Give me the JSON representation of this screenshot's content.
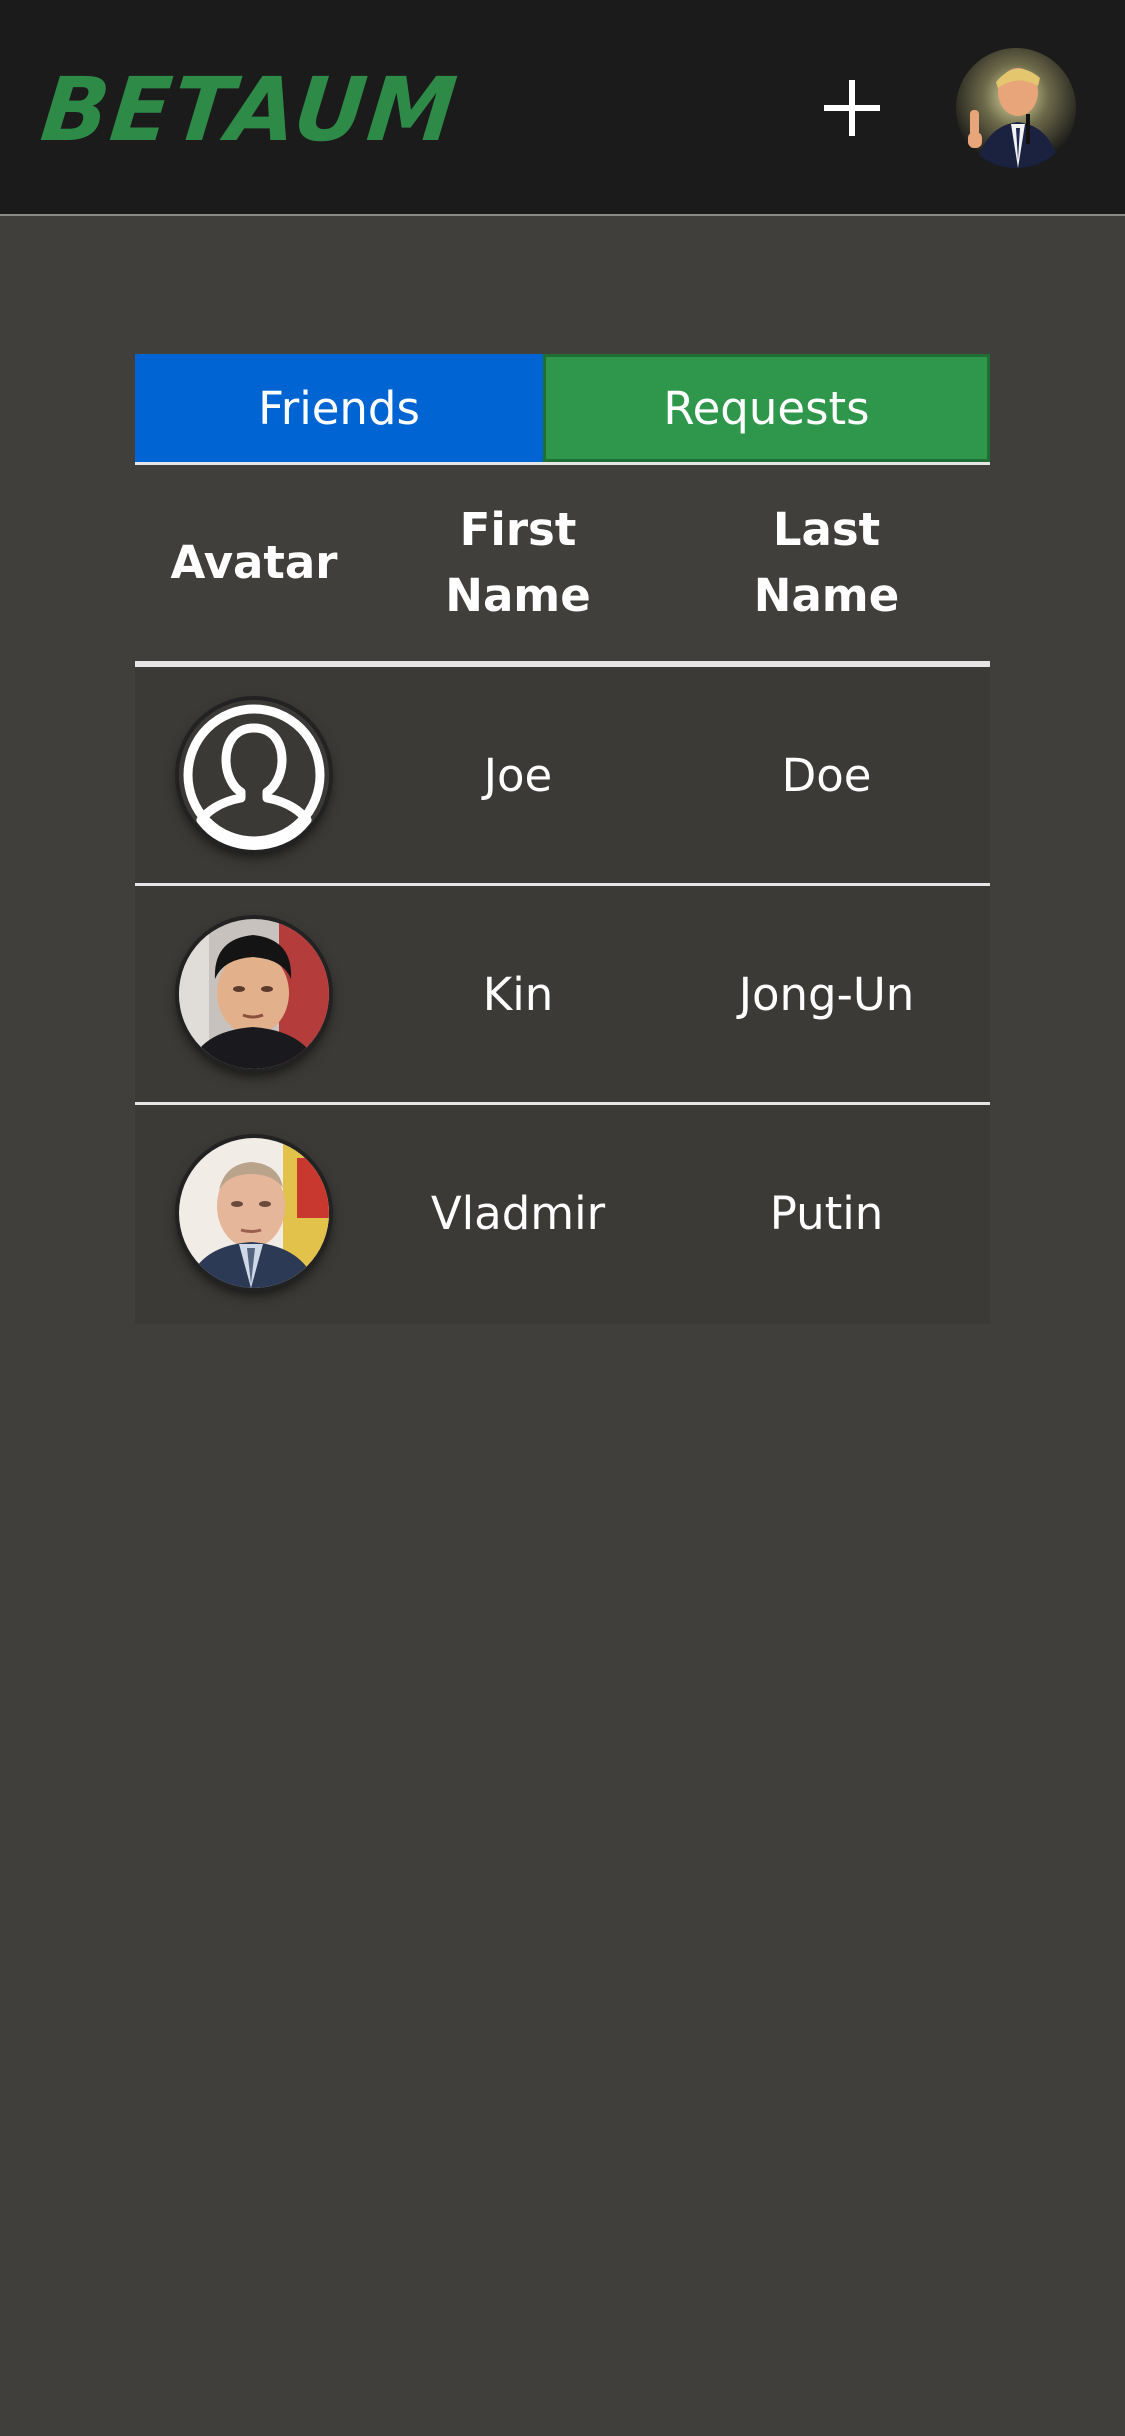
{
  "header": {
    "logo_text": "BETAUM",
    "add_icon": "plus-icon",
    "profile_avatar_icon": "user-avatar-photo",
    "logo_color": "#2e8b47"
  },
  "tabs": [
    {
      "label": "Friends",
      "color": "#0065d3"
    },
    {
      "label": "Requests",
      "color": "#2e974b"
    }
  ],
  "table": {
    "columns": {
      "avatar": "Avatar",
      "first_name_line1": "First",
      "first_name_line2": "Name",
      "last_name_line1": "Last",
      "last_name_line2": "Name"
    },
    "rows": [
      {
        "first_name": "Joe",
        "last_name": "Doe",
        "avatar": "default-user-icon"
      },
      {
        "first_name": "Kin",
        "last_name": "Jong-Un",
        "avatar": "user-photo"
      },
      {
        "first_name": "Vladmir",
        "last_name": "Putin",
        "avatar": "user-photo"
      }
    ]
  }
}
